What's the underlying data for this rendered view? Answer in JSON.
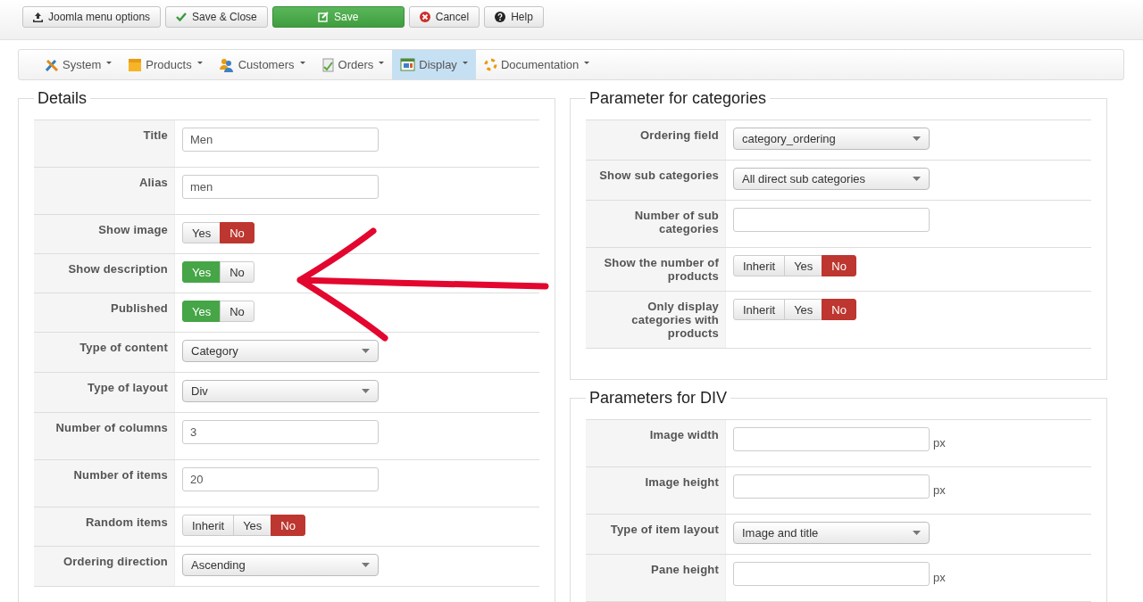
{
  "toolbar": [
    {
      "label": "Joomla menu options",
      "kind": "default"
    },
    {
      "label": "Save & Close",
      "kind": "default"
    },
    {
      "label": "Save",
      "kind": "primary"
    },
    {
      "label": "Cancel",
      "kind": "default"
    },
    {
      "label": "Help",
      "kind": "default"
    }
  ],
  "menu": [
    {
      "label": "System",
      "selected": false
    },
    {
      "label": "Products",
      "selected": false
    },
    {
      "label": "Customers",
      "selected": false
    },
    {
      "label": "Orders",
      "selected": false
    },
    {
      "label": "Display",
      "selected": true
    },
    {
      "label": "Documentation",
      "selected": false
    }
  ],
  "details": {
    "legend": "Details",
    "rows": [
      {
        "label": "Title",
        "kind": "text",
        "value": "Men"
      },
      {
        "label": "Alias",
        "kind": "text",
        "value": "men"
      },
      {
        "label": "Show image",
        "kind": "toggle",
        "options": [
          {
            "label": "Yes",
            "selected": false
          },
          {
            "label": "No",
            "selected": true,
            "color": "#bd362f"
          }
        ]
      },
      {
        "label": "Show description",
        "kind": "toggle",
        "options": [
          {
            "label": "Yes",
            "selected": true,
            "color": "#46a546"
          },
          {
            "label": "No",
            "selected": false
          }
        ]
      },
      {
        "label": "Published",
        "kind": "toggle",
        "options": [
          {
            "label": "Yes",
            "selected": true,
            "color": "#46a546"
          },
          {
            "label": "No",
            "selected": false
          }
        ]
      },
      {
        "label": "Type of content",
        "kind": "select",
        "value": "Category"
      },
      {
        "label": "Type of layout",
        "kind": "select",
        "value": "Div"
      },
      {
        "label": "Number of columns",
        "kind": "text",
        "value": "3"
      },
      {
        "label": "Number of items",
        "kind": "text",
        "value": "20"
      },
      {
        "label": "Random items",
        "kind": "toggle",
        "options": [
          {
            "label": "Inherit",
            "selected": false
          },
          {
            "label": "Yes",
            "selected": false
          },
          {
            "label": "No",
            "selected": true,
            "color": "#bd362f"
          }
        ]
      },
      {
        "label": "Ordering direction",
        "kind": "select",
        "value": "Ascending"
      }
    ]
  },
  "categories": {
    "legend": "Parameter for categories",
    "rows": [
      {
        "label": "Ordering field",
        "kind": "select",
        "value": "category_ordering"
      },
      {
        "label": "Show sub categories",
        "kind": "select",
        "value": "All direct sub categories"
      },
      {
        "label": "Number of sub categories",
        "kind": "text"
      },
      {
        "label": "Show the number of products",
        "kind": "toggle",
        "options": [
          {
            "label": "Inherit",
            "selected": false
          },
          {
            "label": "Yes",
            "selected": false
          },
          {
            "label": "No",
            "selected": true,
            "color": "#bd362f"
          }
        ]
      },
      {
        "label": "Only display categories with products",
        "kind": "toggle",
        "options": [
          {
            "label": "Inherit",
            "selected": false
          },
          {
            "label": "Yes",
            "selected": false
          },
          {
            "label": "No",
            "selected": true,
            "color": "#bd362f"
          }
        ]
      }
    ]
  },
  "div_params": {
    "legend": "Parameters for DIV",
    "rows": [
      {
        "label": "Image width",
        "kind": "text",
        "suffix": "px"
      },
      {
        "label": "Image height",
        "kind": "text",
        "suffix": "px"
      },
      {
        "label": "Type of item layout",
        "kind": "select",
        "value": "Image and title"
      },
      {
        "label": "Pane height",
        "kind": "text",
        "suffix": "px"
      }
    ]
  }
}
